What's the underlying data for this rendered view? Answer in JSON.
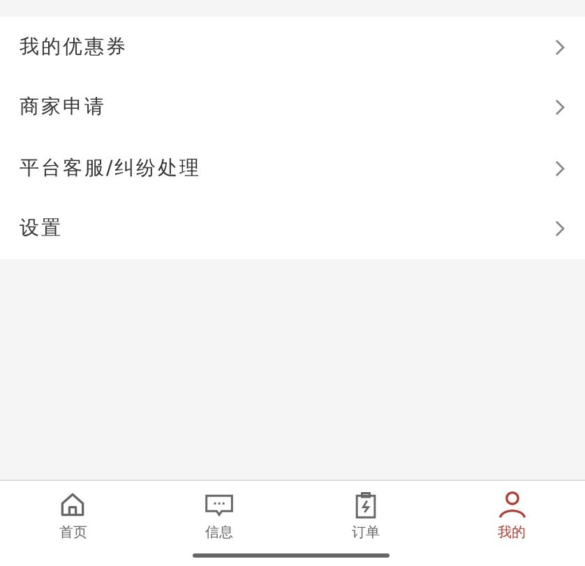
{
  "menu": [
    {
      "label": "我的优惠券"
    },
    {
      "label": "商家申请"
    },
    {
      "label": "平台客服/纠纷处理"
    },
    {
      "label": "设置"
    }
  ],
  "tabs": [
    {
      "label": "首页",
      "kind": "home",
      "selected": false
    },
    {
      "label": "信息",
      "kind": "message",
      "selected": false
    },
    {
      "label": "订单",
      "kind": "order",
      "selected": false
    },
    {
      "label": "我的",
      "kind": "profile",
      "selected": true
    }
  ]
}
